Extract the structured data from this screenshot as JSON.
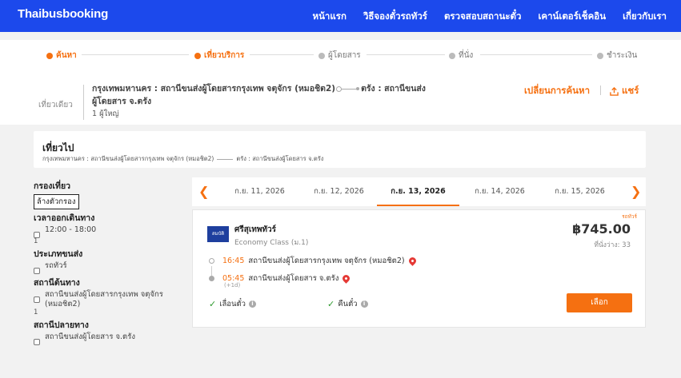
{
  "header": {
    "brand": "Thaibusbooking",
    "nav": [
      "หน้าแรก",
      "วิธีจองตั๋วรถทัวร์",
      "ตรวจสอบสถานะตั๋ว",
      "เคาน์เตอร์เช็คอิน",
      "เกี่ยวกับเรา"
    ],
    "bg_color": "#1c49ec"
  },
  "steps": {
    "items": [
      "ค้นหา",
      "เที่ยวบริการ",
      "ผู้โดยสาร",
      "ที่นั่ง",
      "ชำระเงิน"
    ],
    "active": [
      "ค้นหา",
      "เที่ยวบริการ"
    ],
    "accent_color": "#f57011"
  },
  "summary": {
    "trip_type": "เที่ยวเดียว",
    "origin": "กรุงเทพมหานคร : สถานีขนส่งผู้โดยสารกรุงเทพ จตุจักร (หมอชิต2)",
    "destination": "ตรัง : สถานีขนส่งผู้โดยสาร จ.ตรัง",
    "passengers": "1 ผู้ใหญ่",
    "change_search": "เปลี่ยนการค้นหา",
    "share": "แชร์"
  },
  "outbound": {
    "title": "เที่ยวไป",
    "origin": "กรุงเทพมหานคร : สถานีขนส่งผู้โดยสารกรุงเทพ จตุจักร (หมอชิต2)",
    "destination": "ตรัง : สถานีขนส่งผู้โดยสาร จ.ตรัง"
  },
  "filters": {
    "title": "กรองเที่ยว",
    "clear": "ล้างตัวกรอง",
    "departure_time": {
      "title": "เวลาออกเดินทาง",
      "option": "12:00 - 18:00",
      "count": "1"
    },
    "bus_type": {
      "title": "ประเภทขนส่ง",
      "option": "รถทัวร์",
      "count": "1"
    },
    "origin_station": {
      "title": "สถานีต้นทาง",
      "option": "สถานีขนส่งผู้โดยสารกรุงเทพ จตุจักร (หมอชิต2)",
      "count": "1"
    },
    "dest_station": {
      "title": "สถานีปลายทาง",
      "option": "สถานีขนส่งผู้โดยสาร จ.ตรัง",
      "count": "1"
    }
  },
  "dates": {
    "items": [
      "ก.ย. 11, 2026",
      "ก.ย. 12, 2026",
      "ก.ย. 13, 2026",
      "ก.ย. 14, 2026",
      "ก.ย. 15, 2026"
    ],
    "selected": "ก.ย. 13, 2026"
  },
  "trip": {
    "logo_text": "สมบัติ",
    "operator": "ศรีสุเทพทัวร์",
    "class": "Economy Class (ม.1)",
    "vehicle_tag": "รถทัวร์",
    "price": "฿745.00",
    "seats": "ที่นั่งว่าง: 33",
    "depart_time": "16:45",
    "depart_station": "สถานีขนส่งผู้โดยสารกรุงเทพ จตุจักร (หมอชิต2)",
    "arrive_time": "05:45",
    "arrive_station": "สถานีขนส่งผู้โดยสาร จ.ตรัง",
    "day_offset": "(+1d)",
    "feature_1": "เลื่อนตั๋ว",
    "feature_2": "คืนตั๋ว",
    "select_label": "เลือก"
  }
}
